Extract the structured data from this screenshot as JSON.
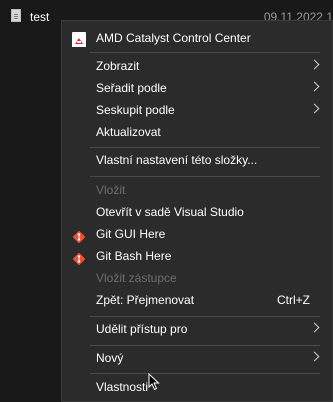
{
  "file": {
    "name": "test",
    "date": "09.11.2022 1"
  },
  "menu": {
    "amd": "AMD Catalyst Control Center",
    "zobrazit": "Zobrazit",
    "seradit": "Seřadit podle",
    "seskupit": "Seskupit podle",
    "aktualizovat": "Aktualizovat",
    "vlastni": "Vlastní nastavení této složky...",
    "vlozit": "Vložit",
    "otevrit_vs": "Otevřít v sadě Visual Studio",
    "git_gui": "Git GUI Here",
    "git_bash": "Git Bash Here",
    "vlozit_zastupce": "Vložit zástupce",
    "zpet": "Zpět: Přejmenovat",
    "zpet_shortcut": "Ctrl+Z",
    "udelit": "Udělit přístup pro",
    "novy": "Nový",
    "vlastnosti": "Vlastnosti"
  },
  "colors": {
    "menu_bg": "#2b2b2b",
    "disabled_text": "#6d6d6d",
    "git_orange": "#f05133"
  },
  "icons": {
    "amd": "amd-icon",
    "git": "git-icon",
    "submenu": "chevron-right-icon"
  }
}
